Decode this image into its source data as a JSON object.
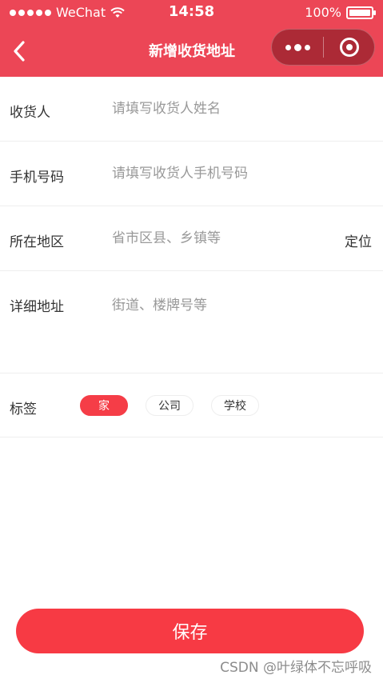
{
  "status_bar": {
    "carrier": "WeChat",
    "time": "14:58",
    "battery": "100%",
    "battery_level": 1.0
  },
  "nav": {
    "title": "新增收货地址",
    "back_icon": "chevron-left-icon",
    "more_icon": "more-dots-icon",
    "close_icon": "target-ring-icon"
  },
  "form": {
    "receiver": {
      "label": "收货人",
      "placeholder": "请填写收货人姓名",
      "value": ""
    },
    "phone": {
      "label": "手机号码",
      "placeholder": "请填写收货人手机号码",
      "value": ""
    },
    "region": {
      "label": "所在地区",
      "placeholder": "省市区县、乡镇等",
      "value": "",
      "locate_label": "定位"
    },
    "detail": {
      "label": "详细地址",
      "placeholder": "街道、楼牌号等",
      "value": ""
    },
    "tags": {
      "label": "标签",
      "items": [
        {
          "label": "家",
          "active": true
        },
        {
          "label": "公司",
          "active": false
        },
        {
          "label": "学校",
          "active": false
        }
      ]
    }
  },
  "save_button": {
    "label": "保存"
  },
  "watermark": "CSDN @叶绿体不忘呼吸",
  "colors": {
    "header_bg": "#ec4656",
    "accent": "#f73a44",
    "placeholder": "#999999",
    "divider": "#eeeeee"
  }
}
